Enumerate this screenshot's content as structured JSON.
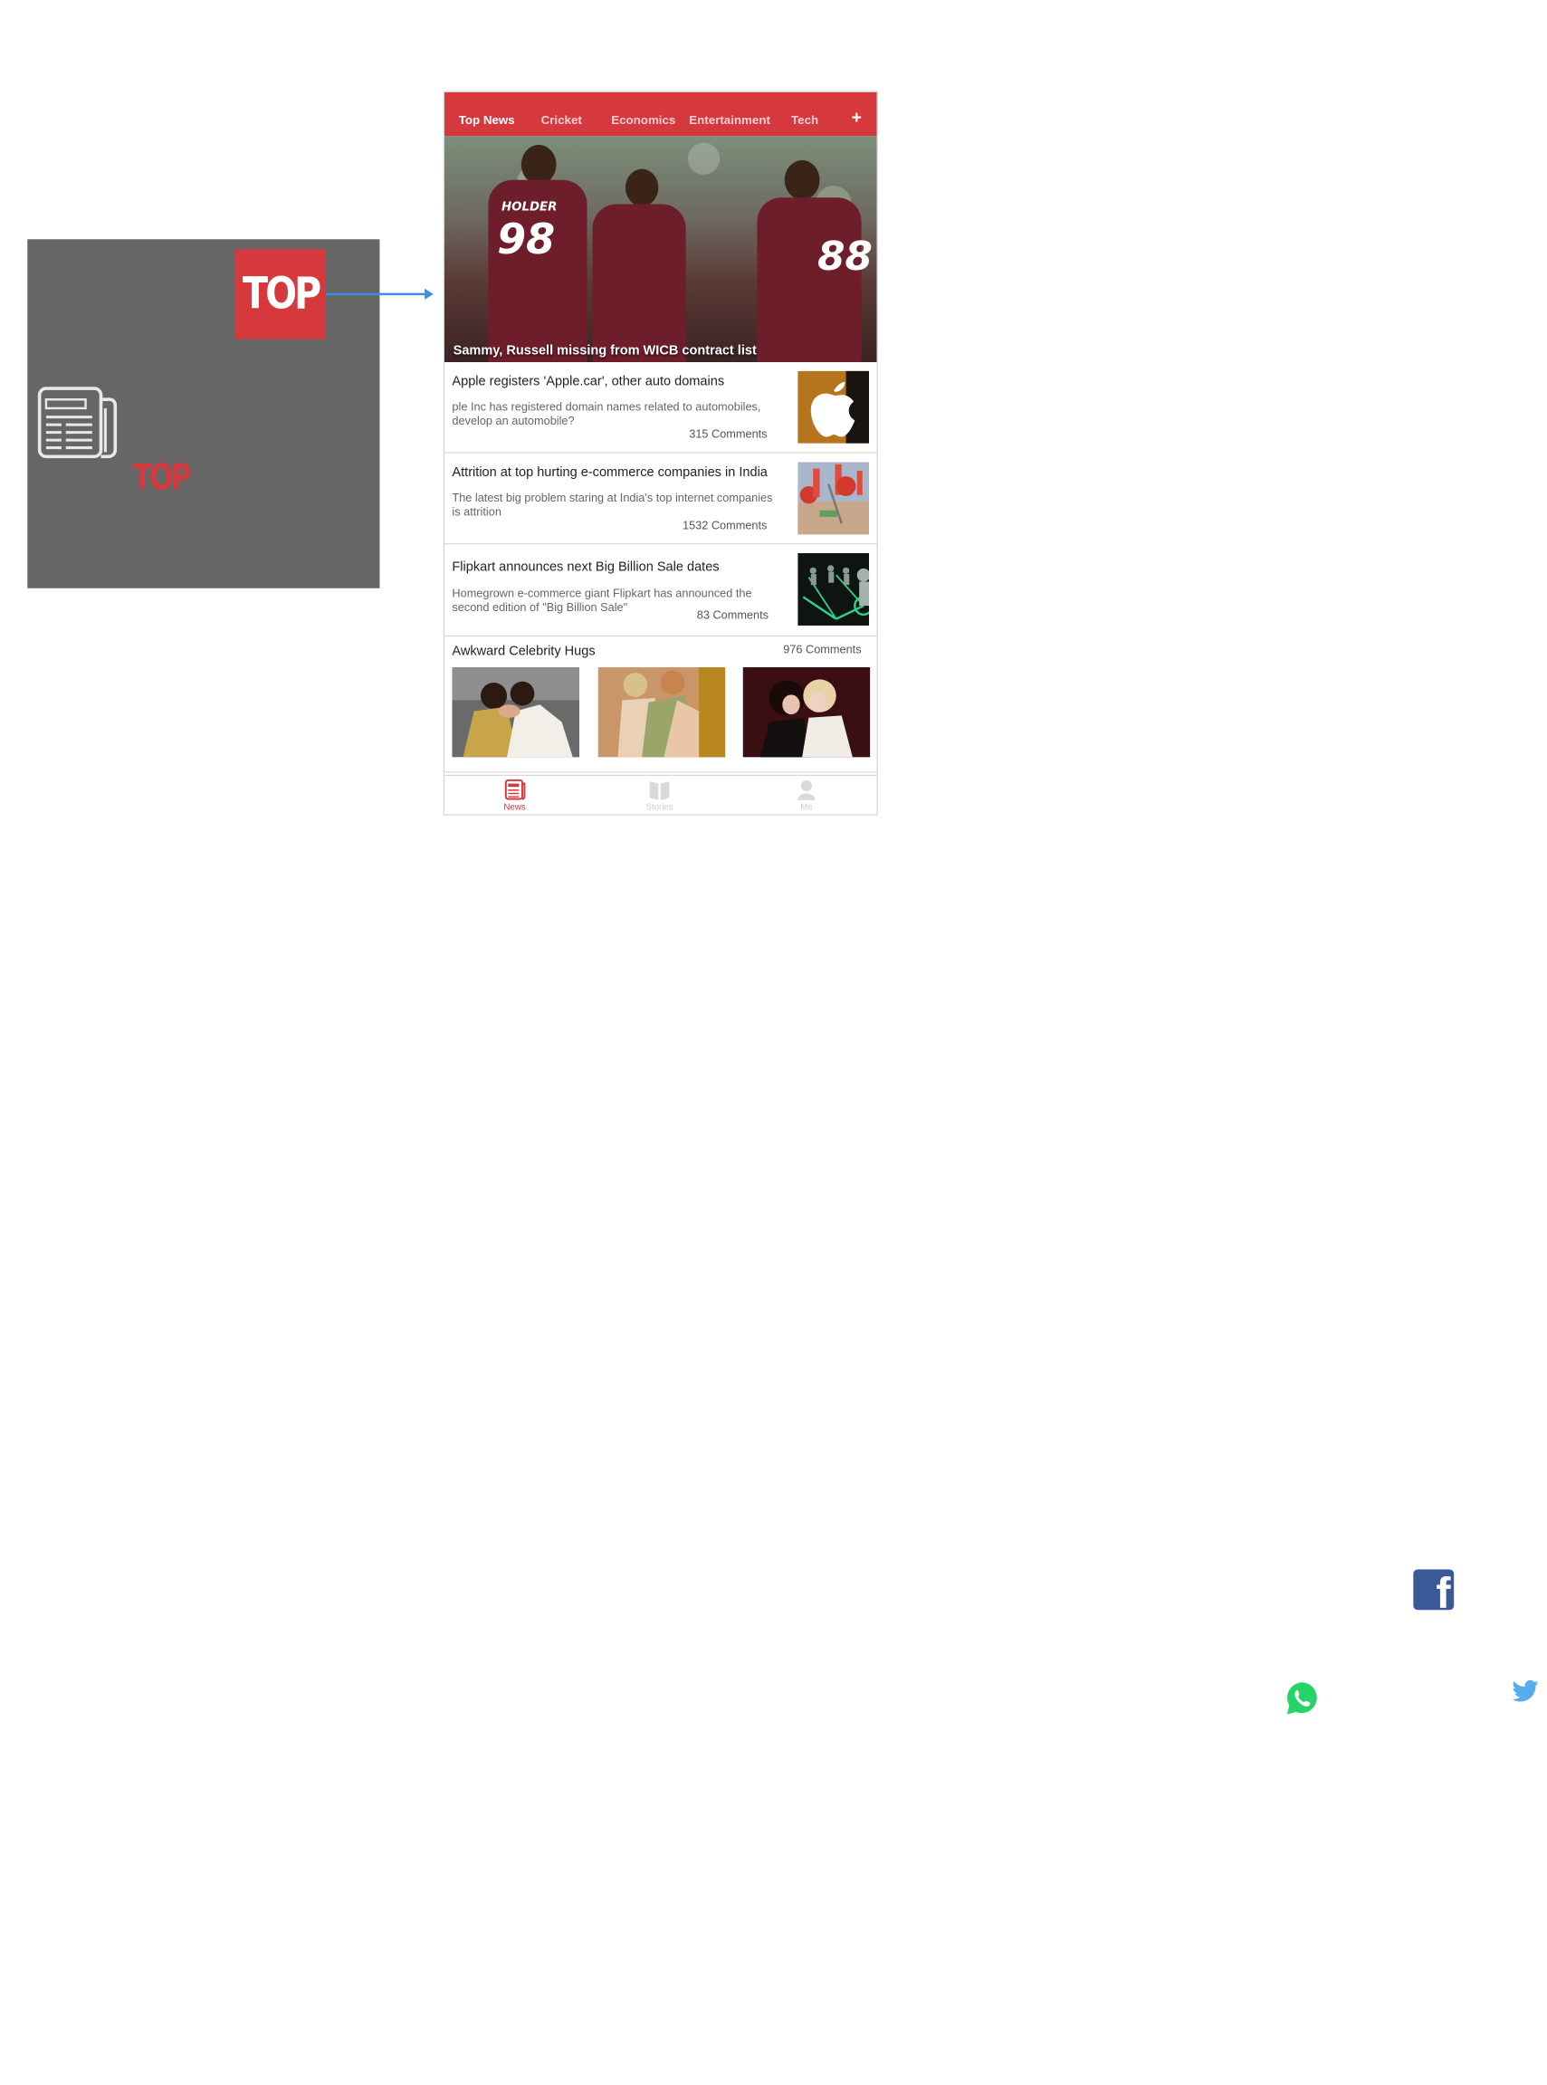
{
  "left_panel": {
    "badge_text": "TOP",
    "red_text": "TOP"
  },
  "phone": {
    "tabs": [
      {
        "label": "Top News",
        "active": true
      },
      {
        "label": "Cricket",
        "active": false
      },
      {
        "label": "Economics",
        "active": false
      },
      {
        "label": "Entertainment",
        "active": false
      },
      {
        "label": "Tech",
        "active": false
      }
    ],
    "add_tab_label": "+",
    "hero": {
      "caption": "Sammy, Russell missing from WICB contract list",
      "jersey_1": "98",
      "jersey_name": "HOLDER",
      "jersey_2": "88"
    },
    "articles": [
      {
        "title": "Apple registers 'Apple.car', other auto domains",
        "summary": "ple Inc has registered domain names related to automobiles, develop an automobile?",
        "comments": "315 Comments"
      },
      {
        "title": "Attrition at top hurting e-commerce companies in India",
        "summary": "The latest big problem staring at India's top internet companies is attrition",
        "comments": "1532 Comments"
      },
      {
        "title": "Flipkart announces next Big Billion Sale dates",
        "summary": "Homegrown e-commerce giant Flipkart has announced the second edition of \"Big Billion Sale\"",
        "comments": "83 Comments"
      }
    ],
    "gallery": {
      "title": "Awkward Celebrity Hugs",
      "comments": "976 Comments"
    },
    "bottom_nav": [
      {
        "label": "News",
        "icon": "newspaper-icon",
        "active": true
      },
      {
        "label": "Stories",
        "icon": "book-icon",
        "active": false
      },
      {
        "label": "Me",
        "icon": "person-icon",
        "active": false
      }
    ]
  },
  "social": {
    "facebook_glyph": "f",
    "icons": [
      "facebook-icon",
      "whatsapp-icon",
      "twitter-icon"
    ]
  },
  "colors": {
    "brand_red": "#d5383d",
    "panel_grey": "#666666",
    "arrow_blue": "#3a8ee6",
    "facebook_blue": "#3b5998",
    "whatsapp_green": "#25d366",
    "twitter_blue": "#55acee"
  }
}
